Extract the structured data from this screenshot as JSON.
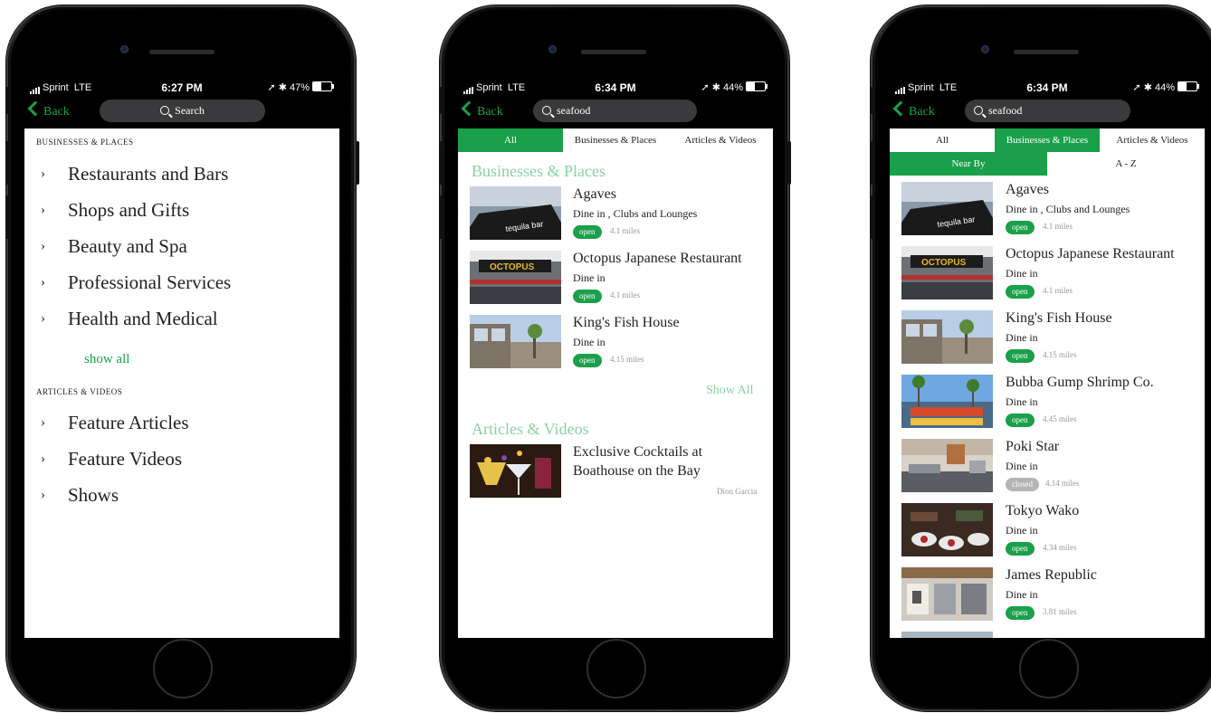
{
  "colors": {
    "accent": "#1aa04a",
    "heading_light_green": "#8ad2a2",
    "closed_badge": "#b5b5b5"
  },
  "screens": [
    {
      "status": {
        "carrier": "Sprint",
        "network": "LTE",
        "time": "6:27 PM",
        "battery": "47%",
        "battery_level": 0.47
      },
      "back_label": "Back",
      "search_placeholder": "Search",
      "businesses_heading": "BUSINESSES & PLACES",
      "categories": [
        "Restaurants and Bars",
        "Shops and Gifts",
        "Beauty and Spa",
        "Professional Services",
        "Health and Medical"
      ],
      "show_all": "show all",
      "articles_heading": "ARTICLES & VIDEOS",
      "article_categories": [
        "Feature Articles",
        "Feature Videos",
        "Shows"
      ]
    },
    {
      "status": {
        "carrier": "Sprint",
        "network": "LTE",
        "time": "6:34 PM",
        "battery": "44%",
        "battery_level": 0.44
      },
      "back_label": "Back",
      "search_value": "seafood",
      "tabs": [
        "All",
        "Businesses & Places",
        "Articles & Videos"
      ],
      "active_tab": 0,
      "businesses_heading": "Businesses & Places",
      "results": [
        {
          "name": "Agaves",
          "category": "Dine in , Clubs and Lounges",
          "status": "open",
          "distance": "4.1 miles"
        },
        {
          "name": "Octopus Japanese Restaurant",
          "category": "Dine in",
          "status": "open",
          "distance": "4.1 miles"
        },
        {
          "name": "King's Fish House",
          "category": "Dine in",
          "status": "open",
          "distance": "4.15 miles"
        }
      ],
      "show_all": "Show All",
      "articles_heading": "Articles & Videos",
      "article": {
        "title_line1": "Exclusive Cocktails at",
        "title_line2": "Boathouse on the Bay",
        "author": "Dion Garcia"
      }
    },
    {
      "status": {
        "carrier": "Sprint",
        "network": "LTE",
        "time": "6:34 PM",
        "battery": "44%",
        "battery_level": 0.44
      },
      "back_label": "Back",
      "search_value": "seafood",
      "tabs": [
        "All",
        "Businesses & Places",
        "Articles & Videos"
      ],
      "active_tab": 1,
      "sort_tabs": [
        "Near By",
        "A - Z"
      ],
      "active_sort": 0,
      "results": [
        {
          "name": "Agaves",
          "category": "Dine in , Clubs and Lounges",
          "status": "open",
          "distance": "4.1 miles"
        },
        {
          "name": "Octopus Japanese Restaurant",
          "category": "Dine in",
          "status": "open",
          "distance": "4.1 miles"
        },
        {
          "name": "King's Fish House",
          "category": "Dine in",
          "status": "open",
          "distance": "4.15 miles"
        },
        {
          "name": "Bubba Gump Shrimp Co.",
          "category": "Dine in",
          "status": "open",
          "distance": "4.45 miles"
        },
        {
          "name": "Poki Star",
          "category": "Dine in",
          "status": "closed",
          "distance": "4.14 miles"
        },
        {
          "name": "Tokyo Wako",
          "category": "Dine in",
          "status": "open",
          "distance": "4.34 miles"
        },
        {
          "name": "James Republic",
          "category": "Dine in",
          "status": "open",
          "distance": "3.81 miles"
        }
      ]
    }
  ]
}
